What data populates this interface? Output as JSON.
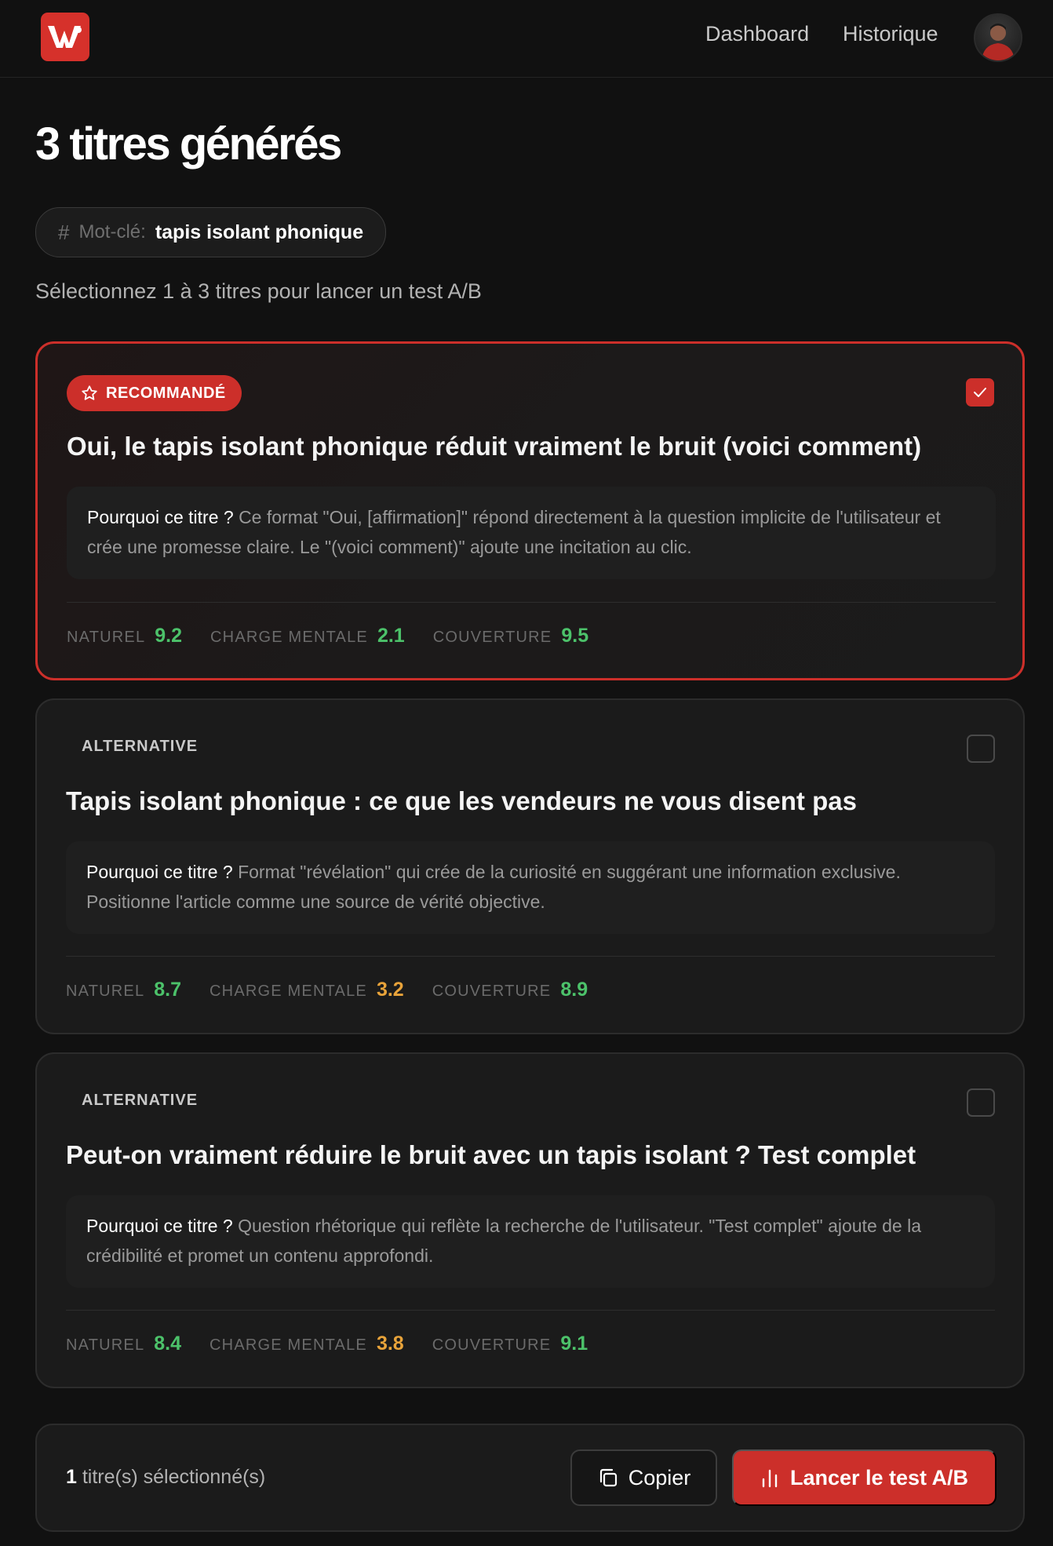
{
  "header": {
    "logo_icon": "brand-w-logo-icon",
    "nav": [
      {
        "label": "Dashboard"
      },
      {
        "label": "Historique"
      }
    ],
    "avatar_icon": "user-avatar"
  },
  "page": {
    "title": "3 titres générés",
    "keyword_label": "Mot-clé:",
    "keyword_value": "tapis isolant phonique",
    "instruction": "Sélectionnez 1 à 3 titres pour lancer un test A/B"
  },
  "titles": [
    {
      "badge": "RECOMMANDÉ",
      "badge_icon": "star-icon",
      "selected": true,
      "title": "Oui, le tapis isolant phonique réduit vraiment le bruit (voici comment)",
      "reason_label": "Pourquoi ce titre ?",
      "reason": "Ce format \"Oui, [affirmation]\" répond directement à la question implicite de l'utilisateur et crée une promesse claire. Le \"(voici comment)\" ajoute une incitation au clic.",
      "metrics": [
        {
          "label": "NATUREL",
          "value": "9.2",
          "color": "#4cc26a"
        },
        {
          "label": "CHARGE MENTALE",
          "value": "2.1",
          "color": "#4cc26a"
        },
        {
          "label": "COUVERTURE",
          "value": "9.5",
          "color": "#4cc26a"
        }
      ]
    },
    {
      "badge": "ALTERNATIVE",
      "selected": false,
      "title": "Tapis isolant phonique : ce que les vendeurs ne vous disent pas",
      "reason_label": "Pourquoi ce titre ?",
      "reason": "Format \"révélation\" qui crée de la curiosité en suggérant une information exclusive. Positionne l'article comme une source de vérité objective.",
      "metrics": [
        {
          "label": "NATUREL",
          "value": "8.7",
          "color": "#4cc26a"
        },
        {
          "label": "CHARGE MENTALE",
          "value": "3.2",
          "color": "#e8a33a"
        },
        {
          "label": "COUVERTURE",
          "value": "8.9",
          "color": "#4cc26a"
        }
      ]
    },
    {
      "badge": "ALTERNATIVE",
      "selected": false,
      "title": "Peut-on vraiment réduire le bruit avec un tapis isolant ? Test complet",
      "reason_label": "Pourquoi ce titre ?",
      "reason": "Question rhétorique qui reflète la recherche de l'utilisateur. \"Test complet\" ajoute de la crédibilité et promet un contenu approfondi.",
      "metrics": [
        {
          "label": "NATUREL",
          "value": "8.4",
          "color": "#4cc26a"
        },
        {
          "label": "CHARGE MENTALE",
          "value": "3.8",
          "color": "#e8a33a"
        },
        {
          "label": "COUVERTURE",
          "value": "9.1",
          "color": "#4cc26a"
        }
      ]
    }
  ],
  "footer": {
    "count": "1",
    "count_suffix": "titre(s) sélectionné(s)",
    "copy_label": "Copier",
    "copy_icon": "copy-icon",
    "launch_label": "Lancer le test A/B",
    "launch_icon": "bar-chart-icon"
  },
  "colors": {
    "accent": "#cc2f2a",
    "score_good": "#4cc26a",
    "score_medium": "#e8a33a",
    "background": "#111111",
    "card": "#1b1b1b"
  }
}
